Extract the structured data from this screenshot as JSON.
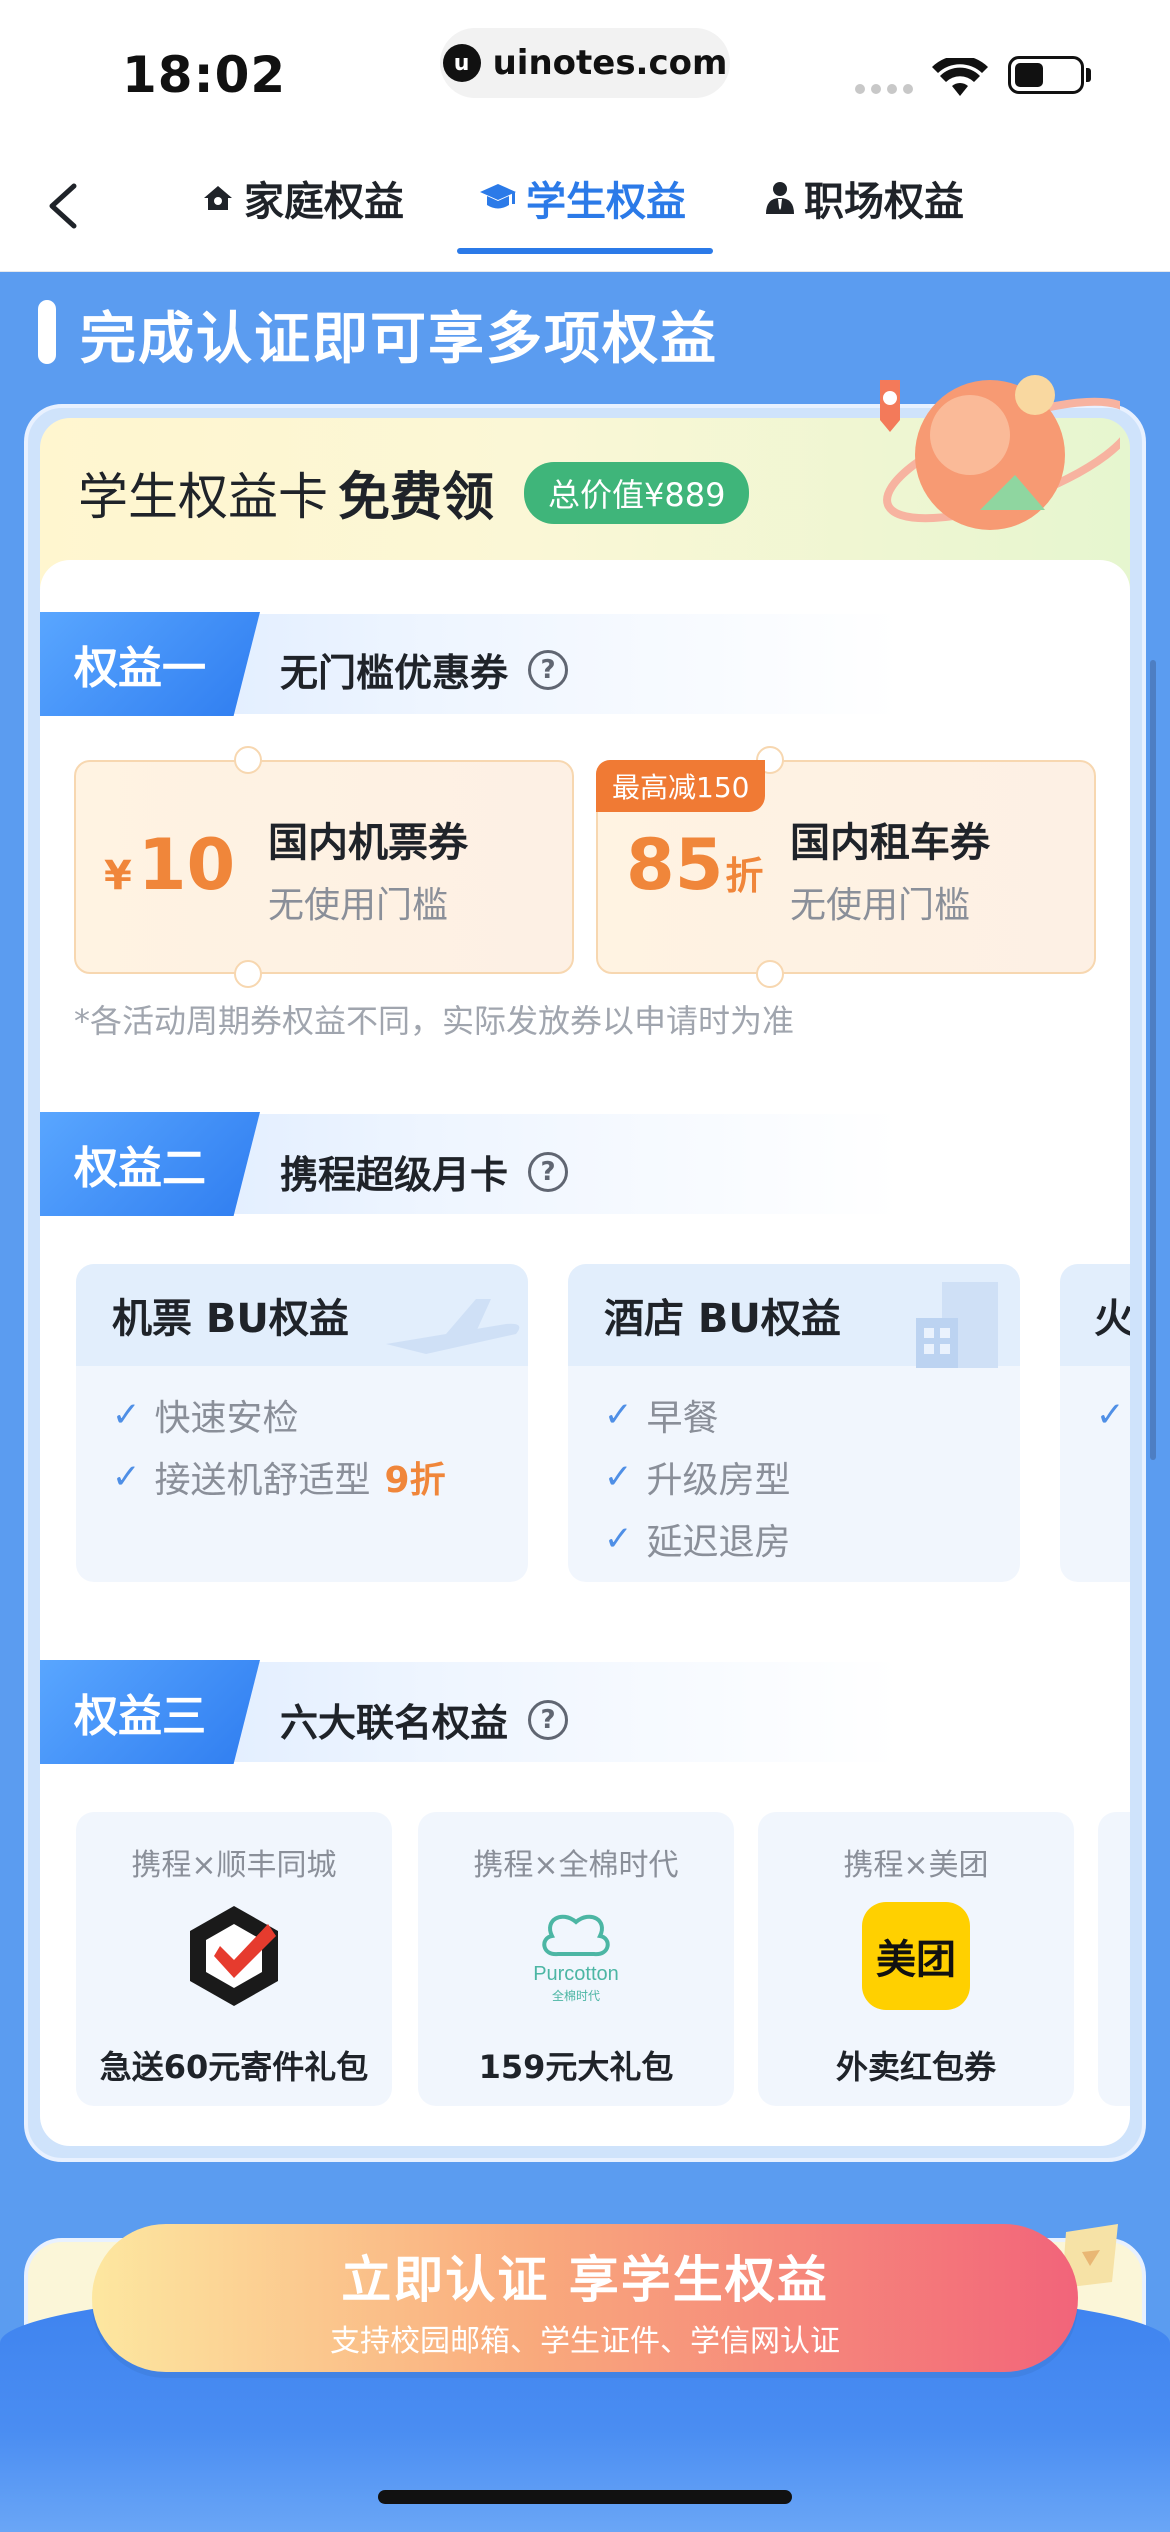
{
  "status_bar": {
    "time": "18:02",
    "url": "uinotes.com",
    "url_icon": "u",
    "battery_level": 0.45
  },
  "tabs": [
    {
      "label": "家庭权益",
      "icon": "home-icon",
      "active": false
    },
    {
      "label": "学生权益",
      "icon": "graduation-cap-icon",
      "active": true
    },
    {
      "label": "职场权益",
      "icon": "person-tie-icon",
      "active": false
    }
  ],
  "headline": "完成认证即可享多项权益",
  "card": {
    "title": "学生权益卡",
    "free": "免费领",
    "total_badge": "总价值¥889"
  },
  "benefit1": {
    "tag": "权益一",
    "label": "无门槛优惠券",
    "coupons": [
      {
        "currency": "¥",
        "value": "10",
        "suffix": "",
        "name": "国内机票券",
        "condition": "无使用门槛",
        "flag": ""
      },
      {
        "currency": "",
        "value": "85",
        "suffix": "折",
        "name": "国内租车券",
        "condition": "无使用门槛",
        "flag": "最高减150"
      }
    ],
    "note": "*各活动周期券权益不同，实际发放券以申请时为准"
  },
  "benefit2": {
    "tag": "权益二",
    "label": "携程超级月卡",
    "cards": [
      {
        "title": "机票 BU权益",
        "items": [
          {
            "text": "快速安检",
            "highlight": ""
          },
          {
            "text": "接送机舒适型",
            "highlight": "9折"
          }
        ]
      },
      {
        "title": "酒店 BU权益",
        "items": [
          {
            "text": "早餐",
            "highlight": ""
          },
          {
            "text": "升级房型",
            "highlight": ""
          },
          {
            "text": "延迟退房",
            "highlight": ""
          }
        ]
      },
      {
        "title": "火",
        "items": []
      }
    ]
  },
  "benefit3": {
    "tag": "权益三",
    "label": "六大联名权益",
    "brands": [
      {
        "partner": "携程×顺丰同城",
        "reward": "急送60元寄件礼包",
        "logo": "sf-intra-city-logo"
      },
      {
        "partner": "携程×全棉时代",
        "reward": "159元大礼包",
        "logo": "purcotton-logo",
        "logo_text": "Purcotton",
        "logo_subtext": "全棉时代"
      },
      {
        "partner": "携程×美团",
        "reward": "外卖红包券",
        "logo": "meituan-logo",
        "logo_text": "美团"
      }
    ]
  },
  "cta": {
    "main": "立即认证 享学生权益",
    "sub": "支持校园邮箱、学生证件、学信网认证"
  },
  "colors": {
    "accent": "#2b7ae8",
    "page_bg": "#5b9cf0",
    "coupon_orange": "#f0863a",
    "badge_green": "#3fb57a"
  }
}
